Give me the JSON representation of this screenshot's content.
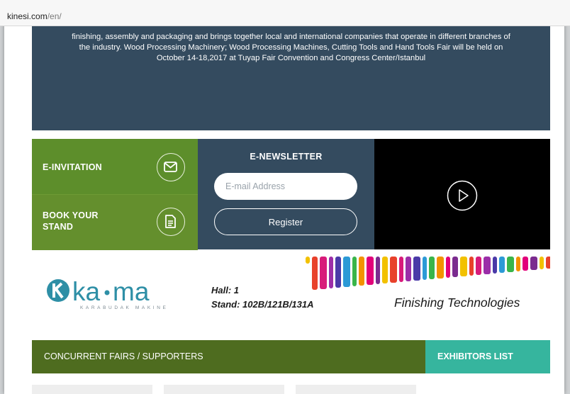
{
  "browser": {
    "url_domain": "kinesi.com",
    "url_path": "/en/"
  },
  "intro": {
    "text_line1": "finishing, assembly and packaging and brings together local and international companies that operate in different branches of",
    "text_line2": "the industry. Wood Processing Machinery; Wood Processing Machines, Cutting Tools and Hand Tools Fair will be held on",
    "text_line3": "October 14-18,2017 at Tuyap Fair Convention and Congress Center/Istanbul"
  },
  "actions": {
    "e_invitation": "E-INVITATION",
    "book_stand": "BOOK YOUR STAND",
    "e_invitation_icon": "envelope-icon",
    "book_stand_icon": "document-icon"
  },
  "newsletter": {
    "title": "E-NEWSLETTER",
    "email_placeholder": "E-mail Address",
    "email_value": "",
    "register_label": "Register"
  },
  "video": {
    "play_icon": "play-icon"
  },
  "sponsor": {
    "brand": "ka·ma",
    "brand_sub": "KARABUDAK MAKINE",
    "hall": "Hall: 1",
    "stand": "Stand: 102B/121B/131A",
    "tagline": "Finishing Technologies"
  },
  "footer_bar": {
    "concurrent": "CONCURRENT FAIRS / SUPPORTERS",
    "exhibitors": "EXHIBITORS LIST"
  },
  "colors": {
    "navy": "#344b5f",
    "green": "#5d8e2b",
    "dark_green": "#4e6c1f",
    "teal": "#36b59e"
  }
}
